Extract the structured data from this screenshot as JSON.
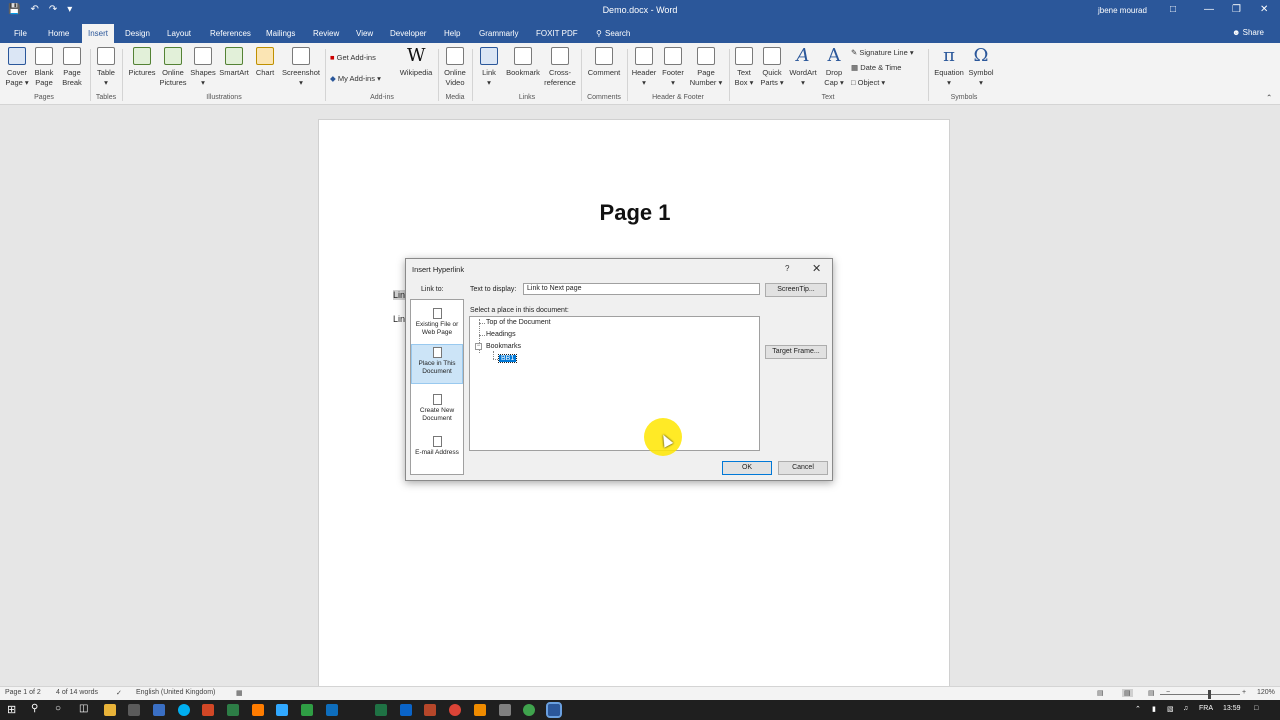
{
  "window": {
    "title": "Demo.docx - Word",
    "user": "jbene mourad",
    "qat_icons": [
      "save-icon",
      "undo-icon",
      "redo-icon",
      "customize-icon"
    ]
  },
  "ribbon": {
    "tabs": [
      "File",
      "Home",
      "Insert",
      "Design",
      "Layout",
      "References",
      "Mailings",
      "Review",
      "View",
      "Developer",
      "Help",
      "Grammarly",
      "FOXIT PDF",
      "Search"
    ],
    "active_tab": "Insert",
    "share": "Share",
    "buttons": {
      "cover_page": [
        "Cover",
        "Page ▾"
      ],
      "blank_page": [
        "Blank",
        "Page"
      ],
      "page_break": [
        "Page",
        "Break"
      ],
      "table": [
        "Table",
        "▾"
      ],
      "pictures": [
        "Pictures",
        ""
      ],
      "online_pictures": [
        "Online",
        "Pictures"
      ],
      "shapes": [
        "Shapes",
        "▾"
      ],
      "smartart": [
        "SmartArt",
        ""
      ],
      "chart": [
        "Chart",
        ""
      ],
      "screenshot": [
        "Screenshot",
        "▾"
      ],
      "get_addins": "Get Add-ins",
      "my_addins": "My Add-ins",
      "wikipedia": [
        "Wikipedia",
        ""
      ],
      "online_video": [
        "Online",
        "Video"
      ],
      "link": [
        "Link",
        "▾"
      ],
      "bookmark": [
        "Bookmark",
        ""
      ],
      "cross_reference": [
        "Cross-",
        "reference"
      ],
      "comment": [
        "Comment",
        ""
      ],
      "header": [
        "Header",
        "▾"
      ],
      "footer": [
        "Footer",
        "▾"
      ],
      "page_number": [
        "Page",
        "Number ▾"
      ],
      "text_box": [
        "Text",
        "Box ▾"
      ],
      "quick_parts": [
        "Quick",
        "Parts ▾"
      ],
      "wordart": [
        "WordArt",
        "▾"
      ],
      "drop_cap": [
        "Drop",
        "Cap ▾"
      ],
      "signature_line": "Signature Line  ▾",
      "date_time": "Date & Time",
      "object": "Object  ▾",
      "equation": [
        "Equation",
        "▾"
      ],
      "symbol": [
        "Symbol",
        "▾"
      ]
    },
    "groups": [
      "Pages",
      "Tables",
      "Illustrations",
      "Add-ins",
      "Media",
      "Links",
      "Comments",
      "Header & Footer",
      "Text",
      "Symbols"
    ]
  },
  "document": {
    "heading": "Page 1",
    "line1": "Lin",
    "line2": "Lin"
  },
  "dialog": {
    "title": "Insert Hyperlink",
    "help": "?",
    "close": "✕",
    "link_to_label": "Link to:",
    "text_to_display_label": "Text to display:",
    "text_to_display_value": "Link to Next page",
    "screentip_button": "ScreenTip...",
    "select_place_label": "Select a place in this document:",
    "target_frame_button": "Target Frame...",
    "ok_button": "OK",
    "cancel_button": "Cancel",
    "link_to_items": [
      "Existing File or Web Page",
      "Place in This Document",
      "Create New Document",
      "E-mail Address"
    ],
    "selected_link_to": "Place in This Document",
    "tree": {
      "top": "Top of the Document",
      "headings": "Headings",
      "bookmarks": "Bookmarks",
      "bookmark_items": [
        "BB1"
      ],
      "selected": "BB1"
    }
  },
  "statusbar": {
    "page": "Page 1 of 2",
    "words": "4 of 14 words",
    "language": "English (United Kingdom)",
    "zoom": "120%"
  },
  "taskbar": {
    "keyboard": "FRA",
    "time": "13:59"
  }
}
